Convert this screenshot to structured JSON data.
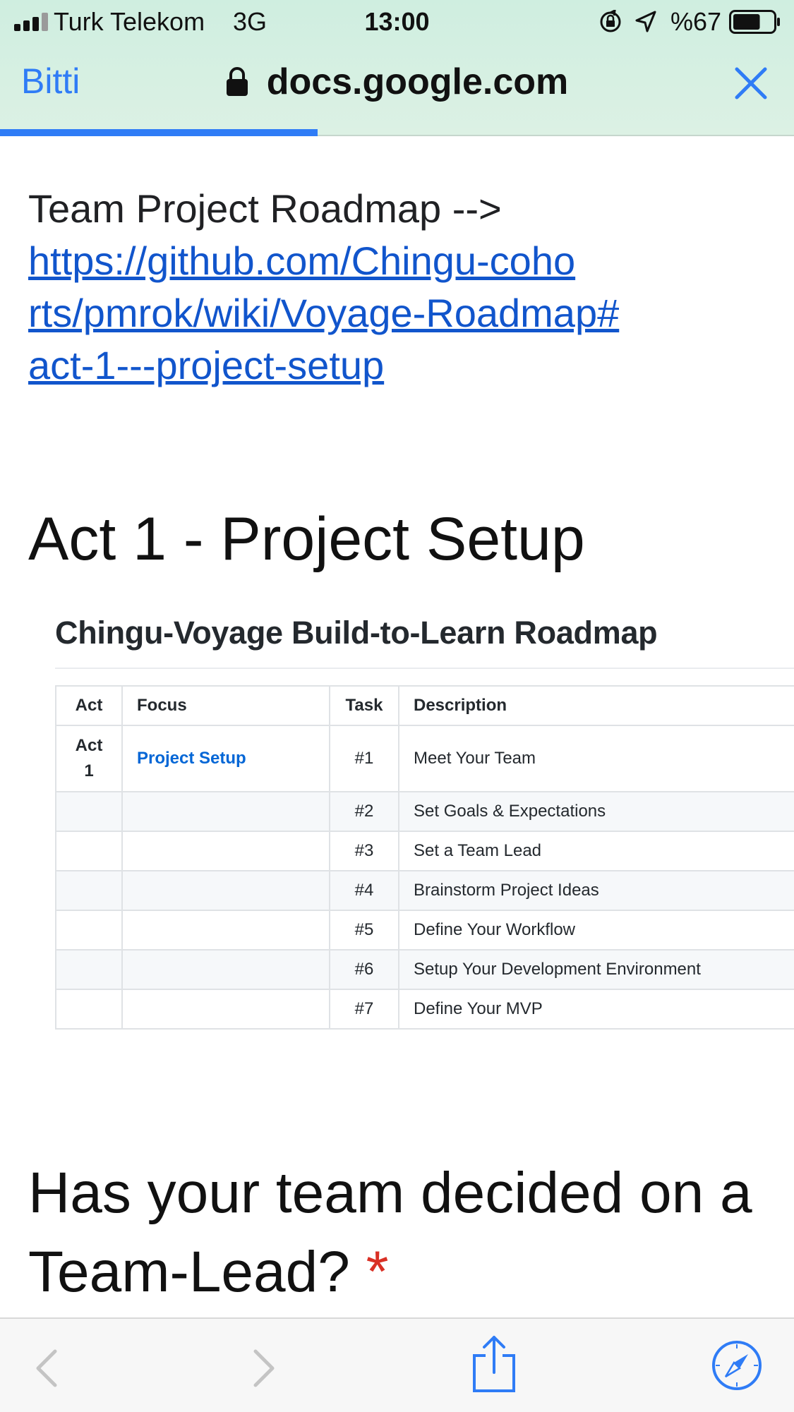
{
  "status_bar": {
    "carrier": "Turk Telekom",
    "network": "3G",
    "time": "13:00",
    "battery_percent": "%67",
    "battery_level": 0.67
  },
  "browser": {
    "done_label": "Bitti",
    "url": "docs.google.com",
    "load_progress": 0.4,
    "accent_color": "#2f7cf6"
  },
  "content": {
    "description_prefix": "Team Project Roadmap -->",
    "link_text": "https://github.com/Chingu-cohorts/pmrok/wiki/Voyage-Roadmap#act-1---project-setup",
    "section_title": "Act 1 - Project Setup",
    "image": {
      "title": "Chingu-Voyage Build-to-Learn Roadmap",
      "headers": [
        "Act",
        "Focus",
        "Task",
        "Description"
      ],
      "first_row": {
        "act": "Act 1",
        "focus": "Project Setup",
        "task": "#1",
        "description": "Meet Your Team"
      },
      "rows": [
        {
          "task": "#2",
          "description": "Set Goals & Expectations"
        },
        {
          "task": "#3",
          "description": "Set a Team Lead"
        },
        {
          "task": "#4",
          "description": "Brainstorm Project Ideas"
        },
        {
          "task": "#5",
          "description": "Define Your Workflow"
        },
        {
          "task": "#6",
          "description": "Setup Your Development Environment"
        },
        {
          "task": "#7",
          "description": "Define Your MVP"
        }
      ]
    },
    "question": "Has your team decided on a Team-Lead?",
    "required_marker": "*"
  },
  "toolbar": {
    "icons": [
      "back-icon",
      "forward-icon",
      "share-icon",
      "safari-compass-icon"
    ]
  }
}
